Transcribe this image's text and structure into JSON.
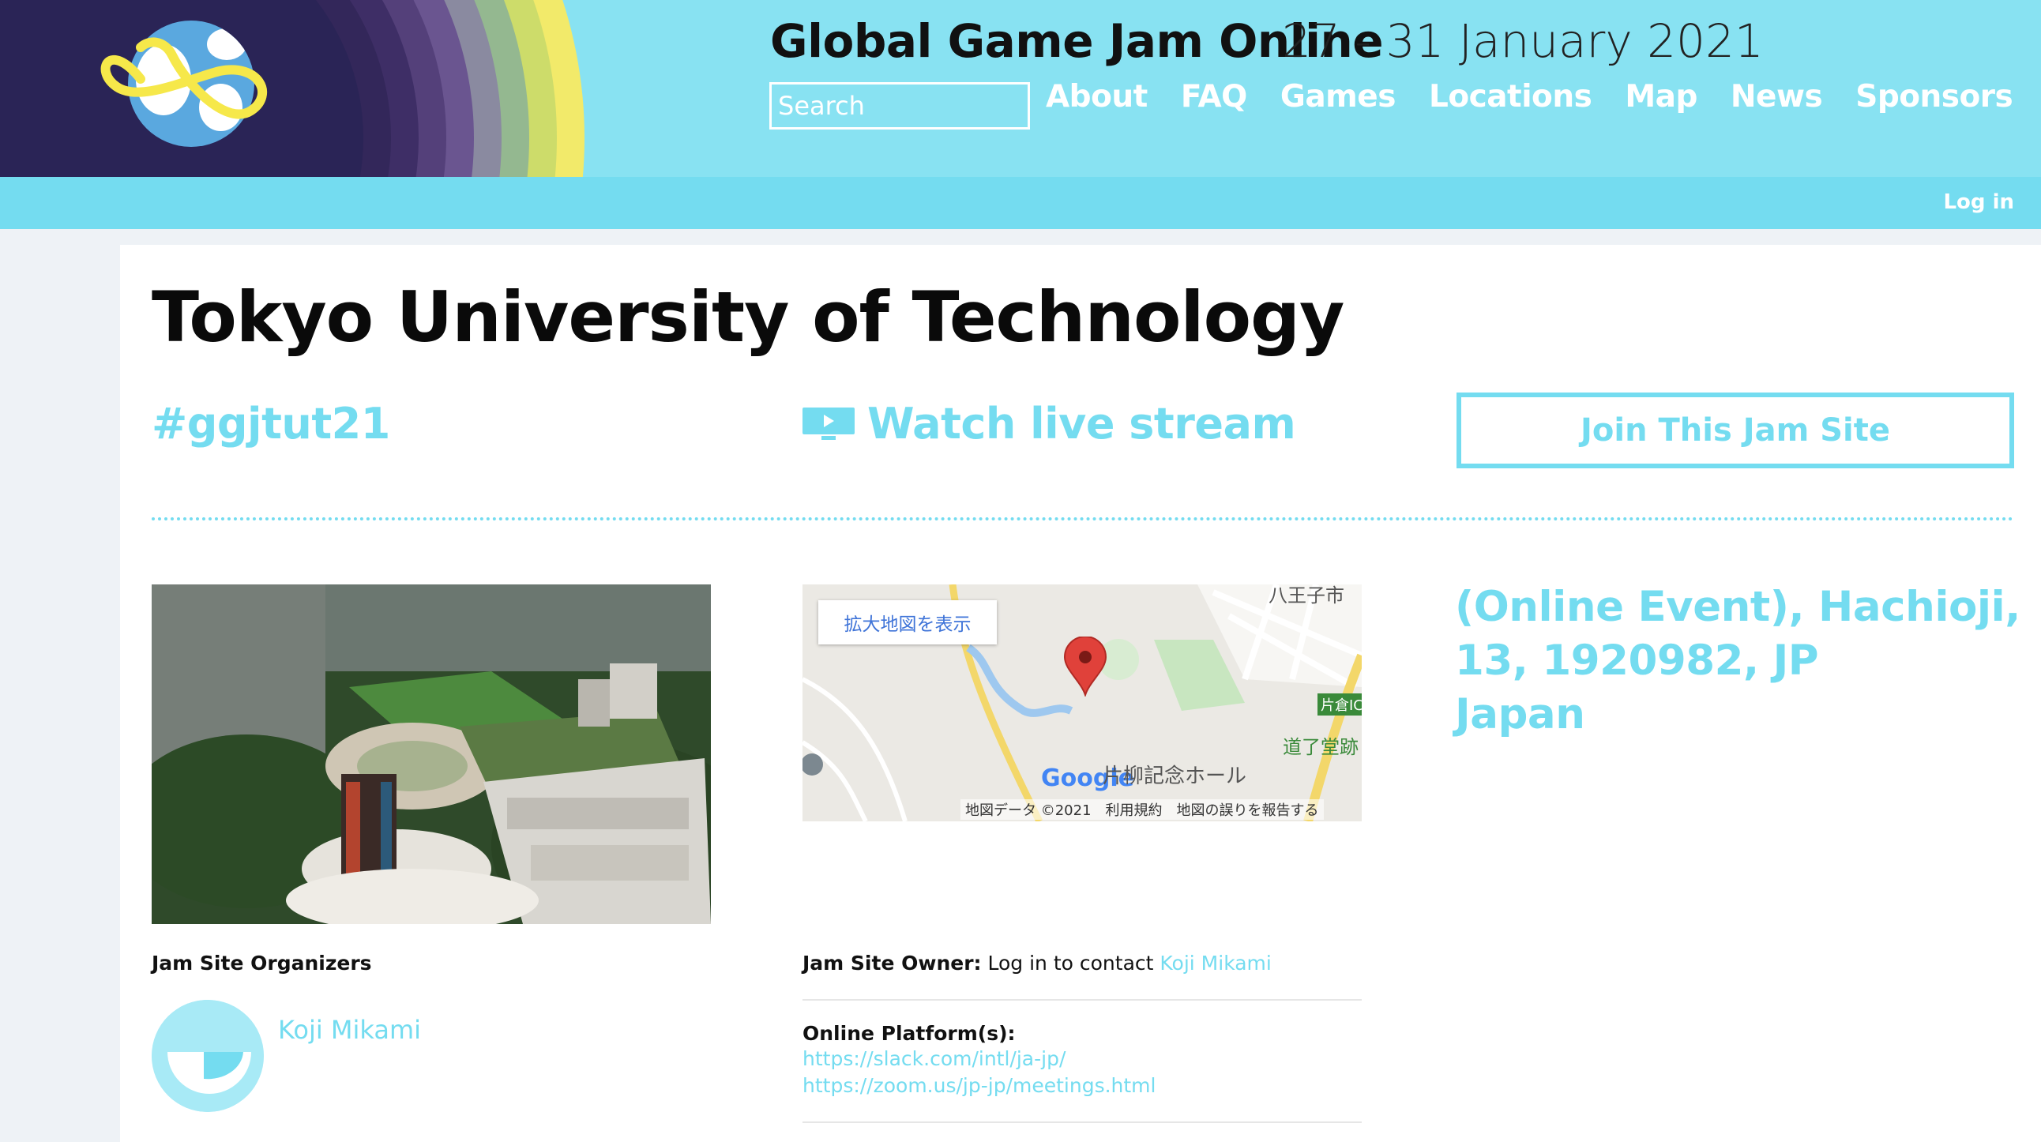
{
  "header": {
    "site_title": "Global Game Jam Online",
    "dates": "27 - 31 January 2021",
    "search_placeholder": "Search",
    "nav": [
      "About",
      "FAQ",
      "Games",
      "Locations",
      "Map",
      "News",
      "Sponsors"
    ],
    "login_label": "Log in"
  },
  "page": {
    "title": "Tokyo University of Technology",
    "hashtag": "#ggjtut21",
    "stream_label": "Watch live stream",
    "join_label": "Join This Jam Site"
  },
  "map": {
    "enlarge_label": "拡大地図を表示",
    "footer": "地図データ ©2021　利用規約　地図の誤りを報告する",
    "google_label": "Google",
    "hall_label": "片柳記念ホール",
    "city_label": "八王子市",
    "road_label": "道了堂跡",
    "ic_label": "片倉IC"
  },
  "address": {
    "line1": "(Online Event), Hachioji,",
    "line2": "13, 1920982, JP",
    "line3": "Japan"
  },
  "organizers": {
    "heading": "Jam Site Organizers",
    "name": "Koji Mikami"
  },
  "owner": {
    "label": "Jam Site Owner:",
    "text": " Log in to contact ",
    "name": "Koji Mikami"
  },
  "platforms": {
    "heading": "Online Platform(s):",
    "links": [
      "https://slack.com/intl/ja-jp/",
      "https://zoom.us/jp-jp/meetings.html"
    ]
  },
  "colors": {
    "accent": "#74dcf0",
    "header_bg": "#88e2f2"
  }
}
